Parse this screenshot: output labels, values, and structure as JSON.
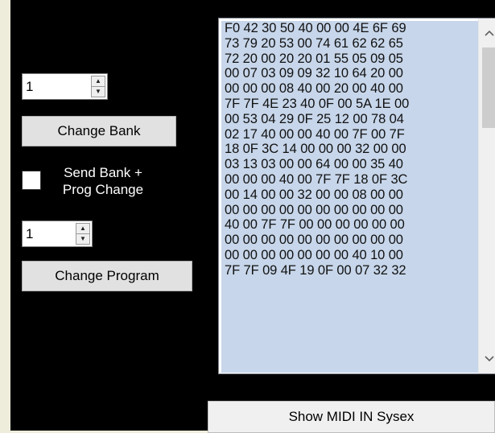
{
  "bank": {
    "value": "1",
    "button_label": "Change Bank"
  },
  "send_option": {
    "label_line1": "Send Bank +",
    "label_line2": "Prog Change",
    "checked": false
  },
  "program": {
    "value": "1",
    "button_label": "Change Program"
  },
  "sysex": {
    "lines": [
      "F0 42 30 50 40 00 00 4E 6F 69",
      "73 79 20 53 00 74 61 62 62 65",
      "72 20 00 20 20 01 55 05 09 05",
      "00 07 03 09 09 32 10 64 20 00",
      "00 00 00 08 40 00 20 00 40 00",
      "7F 7F 4E 23 40 0F 00 5A 1E 00",
      "00 53 04 29 0F 25 12 00 78 04",
      "02 17 40 00 00 40 00 7F 00 7F",
      "18 0F 3C 14 00 00 00 32 00 00",
      "03 13 03 00 00 64 00 00 35 40",
      "00 00 00 40 00 7F 7F 18 0F 3C",
      "00 14 00 00 32 00 00 08 00 00",
      "00 00 00 00 00 00 00 00 00 00",
      "40 00 7F 7F 00 00 00 00 00 00",
      "00 00 00 00 00 00 00 00 00 00",
      "00 00 00 00 00 00 00 40 10 00",
      "7F 7F 09 4F 19 0F 00 07 32 32"
    ],
    "show_button_label": "Show MIDI IN Sysex"
  },
  "icons": {
    "spin_up": "▲",
    "spin_down": "▼",
    "scroll_up": "^",
    "scroll_down": "v"
  },
  "colors": {
    "panel_background": "#000000",
    "page_background": "#eeecdb",
    "selection": "#c7d6ea",
    "button_face": "#e1e1e1"
  }
}
